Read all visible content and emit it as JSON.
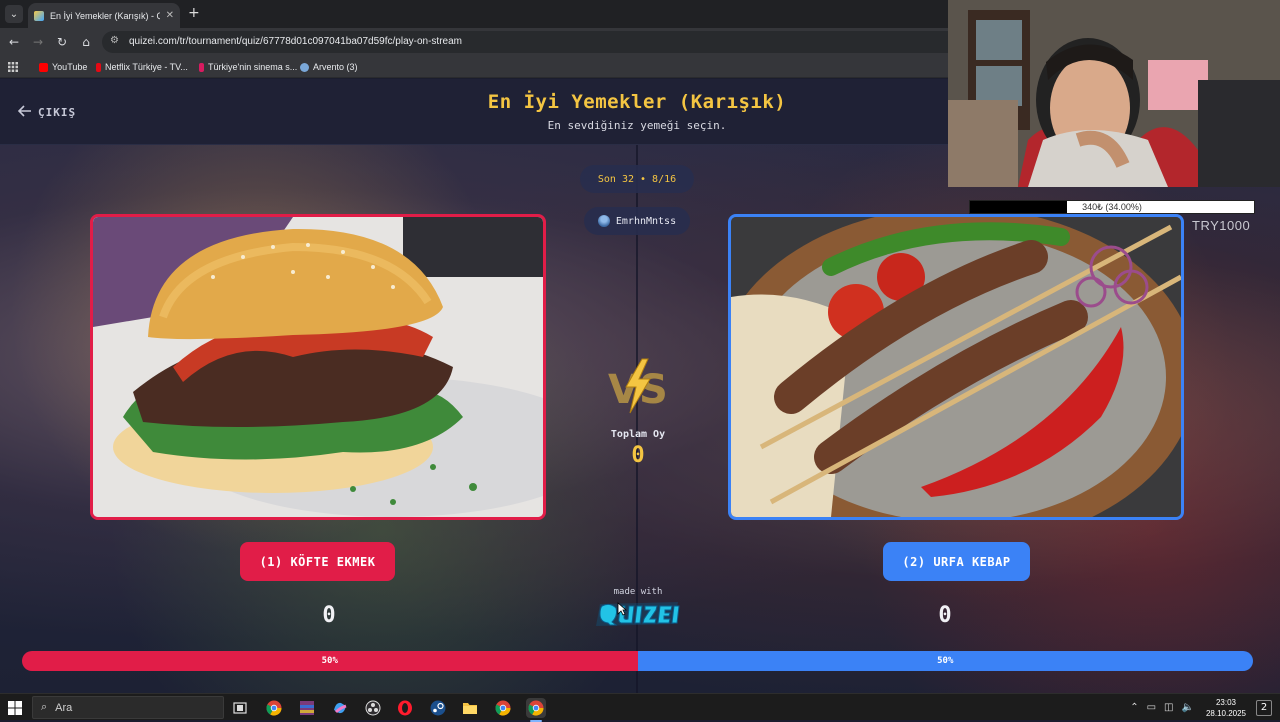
{
  "browser": {
    "tab_title": "En İyi Yemekler (Karışık) - Quize",
    "url": "quizei.com/tr/tournament/quiz/67778d01c097041ba07d59fc/play-on-stream",
    "bookmarks": [
      {
        "label": "YouTube",
        "color": "#ff0000"
      },
      {
        "label": "Netflix Türkiye - TV...",
        "color": "#e50914"
      },
      {
        "label": "Türkiye'nin sinema s...",
        "color": "#d81b60"
      },
      {
        "label": "Arvento (3)",
        "color": "#7aa7d8"
      }
    ]
  },
  "stream_overlay": {
    "donation_text": "340₺ (34.00%)",
    "donation_progress": 0.34,
    "currency_label": "TRY1000"
  },
  "quiz": {
    "exit_label": "ÇIKIŞ",
    "title": "En İyi Yemekler (Karışık)",
    "subtitle": "En sevdiğiniz yemeği seçin.",
    "round": "Son 32 • 8/16",
    "username": "EmrhnMntss",
    "total_votes_label": "Toplam Oy",
    "total_votes": "0",
    "made_with": "made with",
    "logo_text": "QUIZEI",
    "left": {
      "button_label": "(1) KÖFTE EKMEK",
      "votes": "0",
      "percent_label": "50%",
      "share": 0.5
    },
    "right": {
      "button_label": "(2) URFA KEBAP",
      "votes": "0",
      "percent_label": "50%",
      "share": 0.5
    }
  },
  "colors": {
    "accent_yellow": "#f4c542",
    "left_red": "#e11d48",
    "right_blue": "#3b82f6"
  },
  "taskbar": {
    "search_placeholder": "Ara",
    "time": "23:03",
    "date": "28.10.2025"
  }
}
